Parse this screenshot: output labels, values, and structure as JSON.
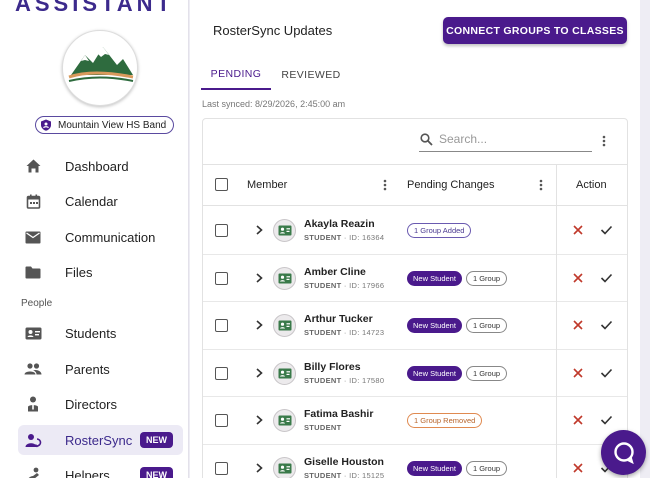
{
  "app": {
    "brand": "ASSISTANT"
  },
  "org": {
    "name": "Mountain View HS Band"
  },
  "sidebar": {
    "items": [
      {
        "label": "Dashboard",
        "icon": "home-icon"
      },
      {
        "label": "Calendar",
        "icon": "calendar-icon"
      },
      {
        "label": "Communication",
        "icon": "mail-icon"
      },
      {
        "label": "Files",
        "icon": "folder-icon"
      }
    ],
    "people_label": "People",
    "people_items": [
      {
        "label": "Students",
        "icon": "id-card-icon"
      },
      {
        "label": "Parents",
        "icon": "people-icon"
      },
      {
        "label": "Directors",
        "icon": "director-icon"
      },
      {
        "label": "RosterSync",
        "icon": "roster-sync-icon",
        "badge": "NEW",
        "active": true
      },
      {
        "label": "Helpers",
        "icon": "helpers-icon",
        "badge": "NEW"
      }
    ]
  },
  "main": {
    "title": "RosterSync Updates",
    "connect_button": "CONNECT GROUPS TO CLASSES",
    "tabs": [
      {
        "label": "PENDING",
        "active": true
      },
      {
        "label": "REVIEWED"
      }
    ],
    "last_synced": "Last synced: 8/29/2026, 2:45:00 am",
    "search_placeholder": "Search...",
    "columns": {
      "member": "Member",
      "pending": "Pending Changes",
      "action": "Action"
    },
    "rows": [
      {
        "name": "Akayla Reazin",
        "role": "STUDENT",
        "id": "· ID: 16364",
        "chips": [
          {
            "text": "1 Group Added",
            "kind": "added"
          }
        ]
      },
      {
        "name": "Amber Cline",
        "role": "STUDENT",
        "id": "· ID: 17966",
        "chips": [
          {
            "text": "New Student",
            "kind": "new"
          },
          {
            "text": "1 Group",
            "kind": "outline"
          }
        ]
      },
      {
        "name": "Arthur Tucker",
        "role": "STUDENT",
        "id": "· ID: 14723",
        "chips": [
          {
            "text": "New Student",
            "kind": "new"
          },
          {
            "text": "1 Group",
            "kind": "outline"
          }
        ]
      },
      {
        "name": "Billy Flores",
        "role": "STUDENT",
        "id": "· ID: 17580",
        "chips": [
          {
            "text": "New Student",
            "kind": "new"
          },
          {
            "text": "1 Group",
            "kind": "outline"
          }
        ]
      },
      {
        "name": "Fatima Bashir",
        "role": "STUDENT",
        "id": "",
        "chips": [
          {
            "text": "1 Group Removed",
            "kind": "removed"
          }
        ]
      },
      {
        "name": "Giselle Houston",
        "role": "STUDENT",
        "id": "· ID: 15125",
        "chips": [
          {
            "text": "New Student",
            "kind": "new"
          },
          {
            "text": "1 Group",
            "kind": "outline"
          }
        ]
      }
    ]
  },
  "colors": {
    "accent": "#4a1a8c",
    "reject": "#c0392b",
    "removed": "#e08a50"
  }
}
